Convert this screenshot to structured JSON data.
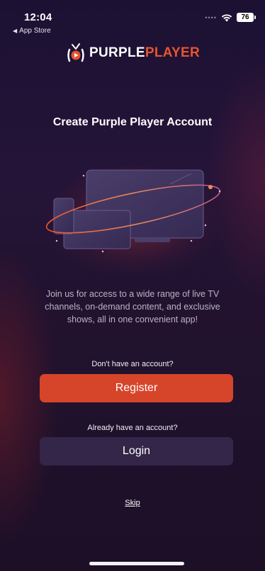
{
  "status_bar": {
    "time": "12:04",
    "back_app": "App Store",
    "signal_dots": "••••",
    "battery": "76"
  },
  "logo": {
    "word1": "PURPLE",
    "word2": "PLAYER",
    "icon": "tv-play-icon"
  },
  "title": "Create Purple Player Account",
  "hero_icon": "devices-illustration",
  "description": "Join us for access to a wide range of live TV channels, on-demand content, and exclusive shows, all in one convenient app!",
  "register_prompt": "Don't have an account?",
  "register_label": "Register",
  "login_prompt": "Already have an account?",
  "login_label": "Login",
  "skip_label": "Skip",
  "colors": {
    "accent": "#d6452a",
    "secondary_button": "#332648",
    "background": "#1f1230"
  }
}
